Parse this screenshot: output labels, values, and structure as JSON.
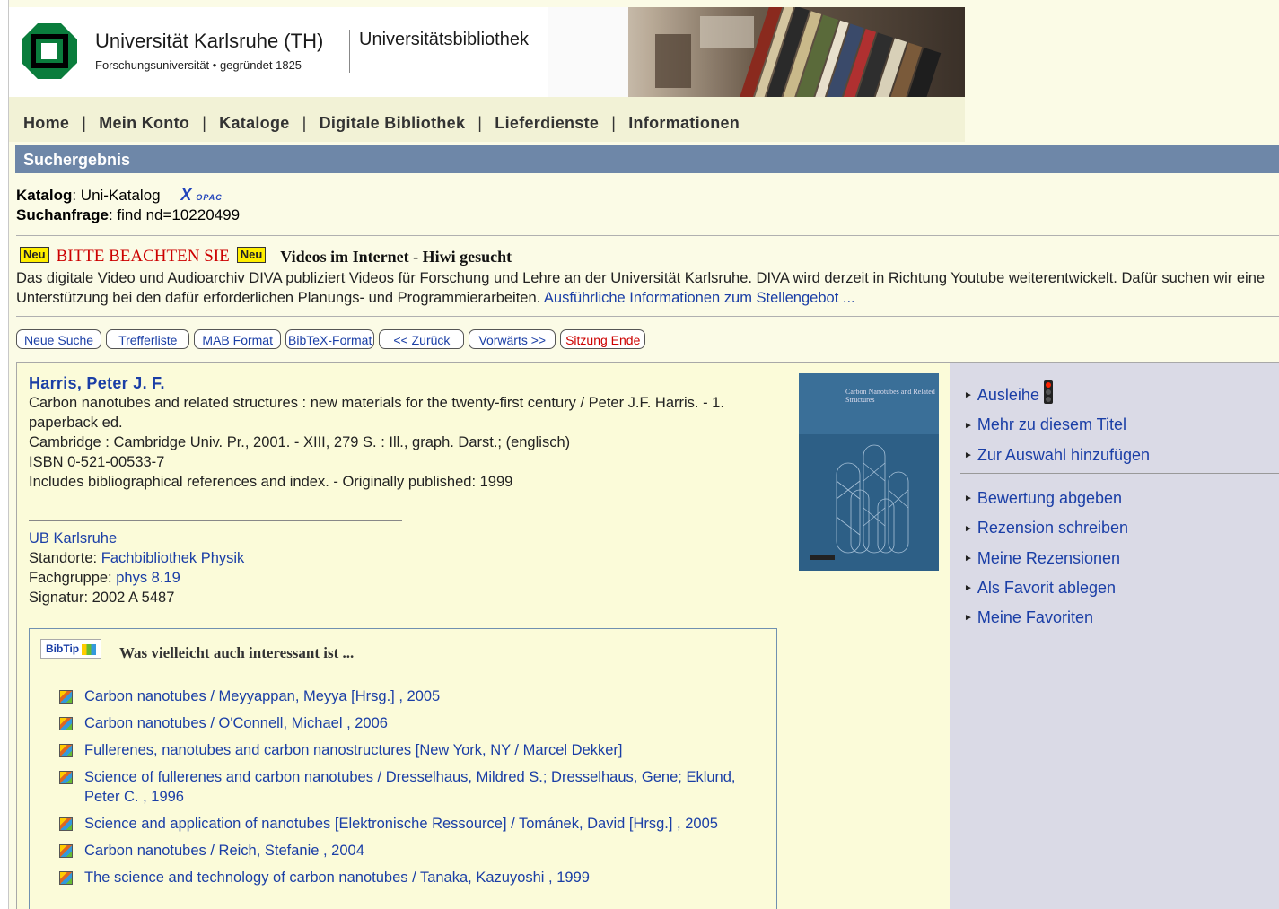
{
  "header": {
    "university_name": "Universität Karlsruhe (TH)",
    "university_subtitle": "Forschungsuniversität • gegründet 1825",
    "library_name": "Universitätsbibliothek"
  },
  "nav": {
    "items": [
      "Home",
      "Mein Konto",
      "Kataloge",
      "Digitale Bibliothek",
      "Lieferdienste",
      "Informationen"
    ],
    "separator": "|"
  },
  "title_bar": "Suchergebnis",
  "search_info": {
    "catalog_label": "Katalog",
    "catalog_value": ": Uni-Katalog",
    "xopac_main": "X",
    "xopac_small": "OPAC",
    "query_label": "Suchanfrage",
    "query_value": ": find nd=10220499"
  },
  "notice": {
    "neu_badge": "Neu",
    "heading": "BITTE BEACHTEN SIE",
    "title": "Videos im Internet - Hiwi gesucht",
    "text": "Das digitale Video und Audioarchiv DIVA publiziert Videos für Forschung und Lehre an der Universität Karlsruhe. DIVA wird derzeit in Richtung Youtube weiterentwickelt. Dafür suchen wir eine Unterstützung bei den dafür erforderlichen Planungs- und Programmierarbeiten. ",
    "link": "Ausführliche Informationen zum Stellengebot ..."
  },
  "buttons": {
    "new_search": "Neue Suche",
    "result_list": "Trefferliste",
    "mab_format": "MAB Format",
    "bibtex_format": "BibTeX-Format",
    "back": "<< Zurück",
    "forward": "Vorwärts >>",
    "end_session": "Sitzung Ende"
  },
  "record": {
    "author": "Harris, Peter J. F.",
    "title": "Carbon nanotubes and related structures : new materials for the twenty-first century / Peter J.F. Harris. - 1. paperback ed.",
    "publication": "Cambridge : Cambridge Univ. Pr., 2001. - XIII, 279 S. : Ill., graph. Darst.; (englisch)",
    "isbn": "ISBN 0-521-00533-7",
    "notes": "Includes bibliographical references and index. - Originally published: 1999"
  },
  "holdings": {
    "library": "UB Karlsruhe",
    "location_label": "Standorte: ",
    "location_value": "Fachbibliothek Physik",
    "group_label": "Fachgruppe: ",
    "group_value": "phys 8.19",
    "signature": "Signatur: 2002 A 5487"
  },
  "cover": {
    "title": "Carbon Nanotubes and Related Structures"
  },
  "bibtip": {
    "logo": "BibTip",
    "heading": "Was vielleicht auch interessant ist ...",
    "items": [
      "Carbon nanotubes / Meyyappan, Meyya [Hrsg.] , 2005",
      "Carbon nanotubes / O'Connell, Michael , 2006",
      "Fullerenes, nanotubes and carbon nanostructures [New York, NY / Marcel Dekker]",
      "Science of fullerenes and carbon nanotubes / Dresselhaus, Mildred S.; Dresselhaus, Gene; Eklund, Peter C. , 1996",
      "Science and application of nanotubes [Elektronische Ressource] / Tománek, David [Hrsg.] , 2005",
      "Carbon nanotubes / Reich, Stefanie , 2004",
      "The science and technology of carbon nanotubes / Tanaka, Kazuyoshi , 1999"
    ]
  },
  "sidebar": {
    "group1": [
      "Ausleihe",
      "Mehr zu diesem Titel",
      "Zur Auswahl hinzufügen"
    ],
    "group2": [
      "Bewertung abgeben",
      "Rezension schreiben",
      "Meine Rezensionen",
      "Als Favorit ablegen",
      "Meine Favoriten"
    ]
  },
  "colors": {
    "link": "#1a3ea6",
    "title_bar": "#6e87a8",
    "page_bg": "#fbfbe6",
    "alert": "#cc0000",
    "logo_green": "#0a7d3c"
  }
}
